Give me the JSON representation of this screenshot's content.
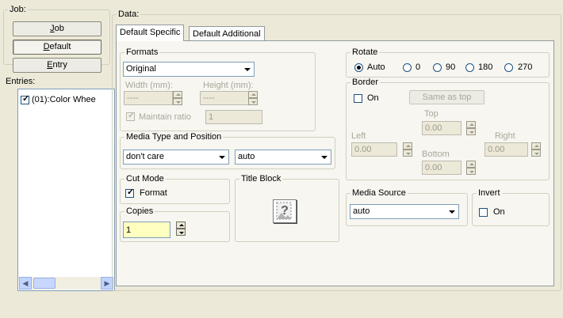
{
  "job_group": {
    "legend": "Job:",
    "job_button": "Job",
    "default_button": "Default",
    "entry_button": "Entry"
  },
  "entries_group": {
    "legend": "Entries:",
    "items": [
      {
        "label": "(01):Color Whee",
        "checked": true
      }
    ]
  },
  "data_group": {
    "legend": "Data:",
    "tabs": [
      "Default Specific",
      "Default Additional"
    ],
    "active_tab": "Default Specific"
  },
  "formats": {
    "legend": "Formats",
    "selected": "Original",
    "width_label": "Width (mm):",
    "height_label": "Height (mm):",
    "width_value": "----",
    "height_value": "----",
    "maintain_ratio_label": "Maintain ratio",
    "maintain_ratio_checked": true,
    "ratio_value": "1"
  },
  "media_type": {
    "legend": "Media Type and Position",
    "type_value": "don't care",
    "position_value": "auto"
  },
  "cut_mode": {
    "legend": "Cut Mode",
    "format_label": "Format",
    "format_checked": true
  },
  "title_block": {
    "legend": "Title Block",
    "icon": "missing-image-question-icon"
  },
  "copies": {
    "legend": "Copies",
    "value": "1"
  },
  "rotate": {
    "legend": "Rotate",
    "options": [
      "Auto",
      "0",
      "90",
      "180",
      "270"
    ],
    "selected": "Auto"
  },
  "border": {
    "legend": "Border",
    "on_label": "On",
    "on_checked": false,
    "same_as_top_button": "Same as top",
    "top_label": "Top",
    "left_label": "Left",
    "right_label": "Right",
    "bottom_label": "Bottom",
    "top_value": "0.00",
    "left_value": "0.00",
    "right_value": "0.00",
    "bottom_value": "0.00"
  },
  "media_source": {
    "legend": "Media Source",
    "value": "auto"
  },
  "invert": {
    "legend": "Invert",
    "on_label": "On",
    "on_checked": false
  },
  "colors": {
    "window_bg": "#ece9d8",
    "copies_field_bg": "#ffffc0",
    "checkbox_green": "#21a121",
    "input_border": "#7f9db9"
  }
}
